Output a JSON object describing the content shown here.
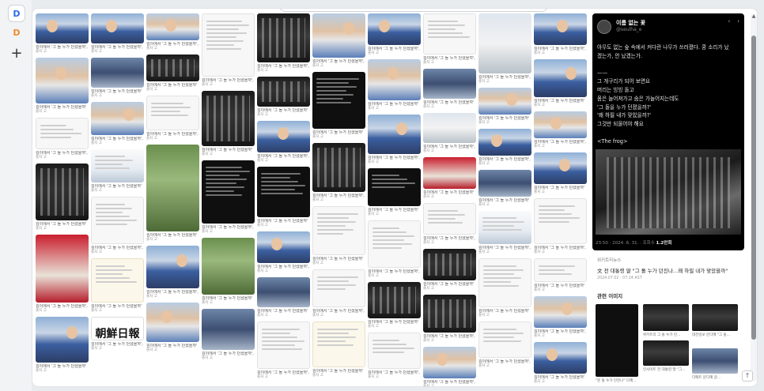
{
  "sidebar": {
    "app_icon": "D",
    "app_icon_2": "D",
    "new_tab_label": "+"
  },
  "grid_caption": "깊이에서 '그 돌 누가 던졌을까', 왜 하…",
  "grid_caption_short": "깊이에서 '그 돌 누가 던졌을까'",
  "grid_source": "출처 고",
  "chosun_logo": "朝鮮日報",
  "post": {
    "author": "이름 없는 꽃",
    "handle": "@seulha_e",
    "nav_prev": "‹",
    "nav_next": "›",
    "body": "아무도 없는 숲 속에서 커다란 나무가 쓰러졌다. 쿵 소리가 났\n겠는가, 안 났겠는가.\n\n——\n그 개구리가 되어 보면요\n머리는 빙빙 돌고\n몸은 늘어져가고 숨은 가늘어지는데도\n'그 돌을 누가 던졌을까?'\n'왜 하필 내가 맞았을까?'\n그것만 되물어야 해요\n\n<The frog>",
    "meta_time": "23:50 · 2024. 6. 31. · 조회수 ",
    "meta_views": "1.2만회"
  },
  "link": {
    "site": "위키트리뉴스",
    "title": "文 전 대통령 딸 \"그 돌 누가 던진나…왜 하필 내가 맞았을까\"",
    "date": "2024.07.02 · 07:24 AST"
  },
  "related": {
    "title": "관련 이미지",
    "captions": [
      "\"문 돌 누가 던진나\" 다혜…",
      "위키트리 그 돌 누가 던…",
      "대전일보 문다혜 \"그 돌…",
      "",
      "인사이트 전 대통령 딸 \"그…",
      "더팩트 문다혜 글…"
    ]
  },
  "scroll": {
    "up_arrow": "▲",
    "to_top": "↑"
  }
}
